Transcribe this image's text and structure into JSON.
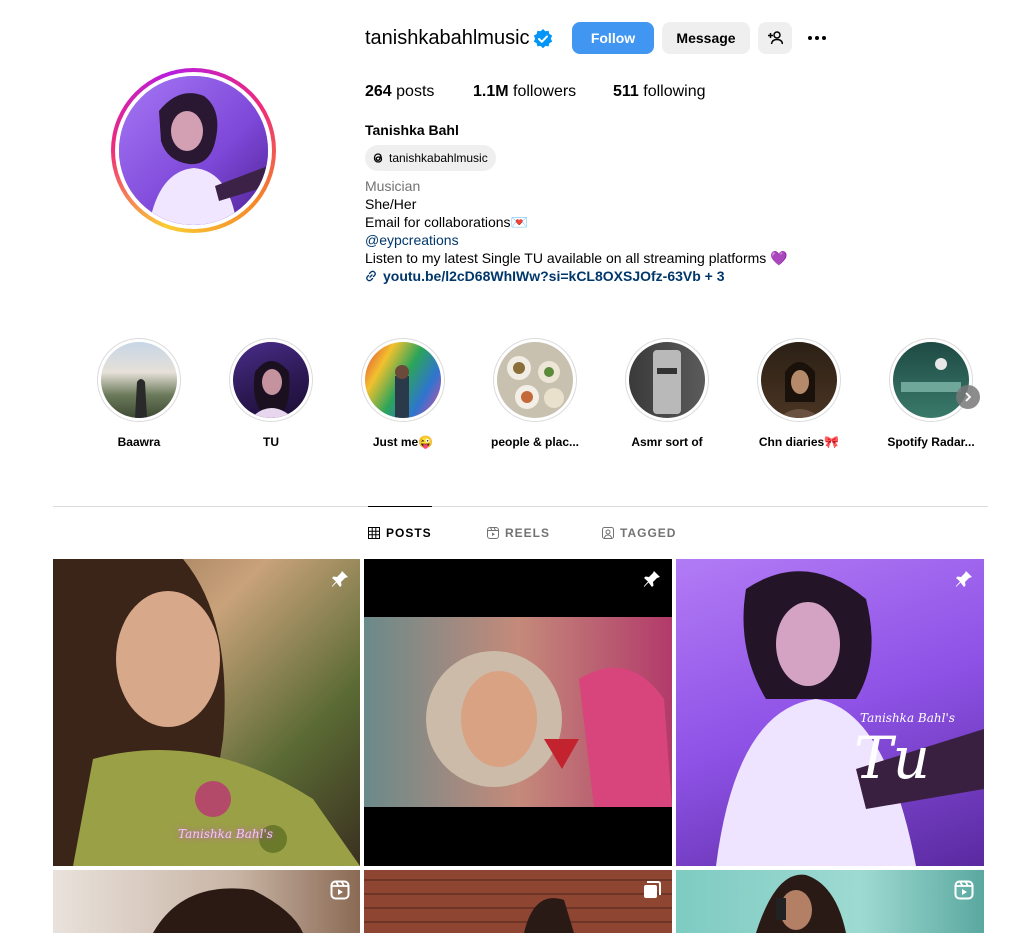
{
  "profile": {
    "username": "tanishkabahlmusic",
    "follow_label": "Follow",
    "message_label": "Message",
    "posts_count": "264",
    "posts_label": "posts",
    "followers_count": "1.1M",
    "followers_label": "followers",
    "following_count": "511",
    "following_label": "following",
    "full_name": "Tanishka Bahl",
    "threads_handle": "tanishkabahlmusic",
    "category": "Musician",
    "bio_lines": [
      "She/Her",
      "Email for collaborations💌",
      "@eypcreations",
      "Listen to my latest Single TU available on all streaming platforms 💜"
    ],
    "link": "youtu.be/l2cD68WhIWw?si=kCL8OXSJOfz-63Vb + 3"
  },
  "highlights": [
    {
      "label": "Baawra"
    },
    {
      "label": "TU"
    },
    {
      "label": "Just me😜"
    },
    {
      "label": "people & plac..."
    },
    {
      "label": "Asmr sort of"
    },
    {
      "label": "Chn diaries🎀"
    },
    {
      "label": "Spotify Radar..."
    }
  ],
  "tabs": [
    {
      "label": "POSTS",
      "icon": "grid-icon"
    },
    {
      "label": "REELS",
      "icon": "reels-icon"
    },
    {
      "label": "TAGGED",
      "icon": "tagged-icon"
    }
  ],
  "posts": [
    {
      "icon": "pin-icon",
      "overlay_text": "Tanishka Bahl's"
    },
    {
      "icon": "pin-icon"
    },
    {
      "icon": "pin-icon",
      "overlay_text": "Tanishka Bahl's",
      "overlay_title": "Tu"
    },
    {
      "icon": "reel-icon"
    },
    {
      "icon": "carousel-icon"
    },
    {
      "icon": "reel-icon"
    }
  ],
  "colors": {
    "accent": "#4096f0",
    "link": "#00376b",
    "muted": "#737373",
    "border": "#dbdbdb"
  }
}
